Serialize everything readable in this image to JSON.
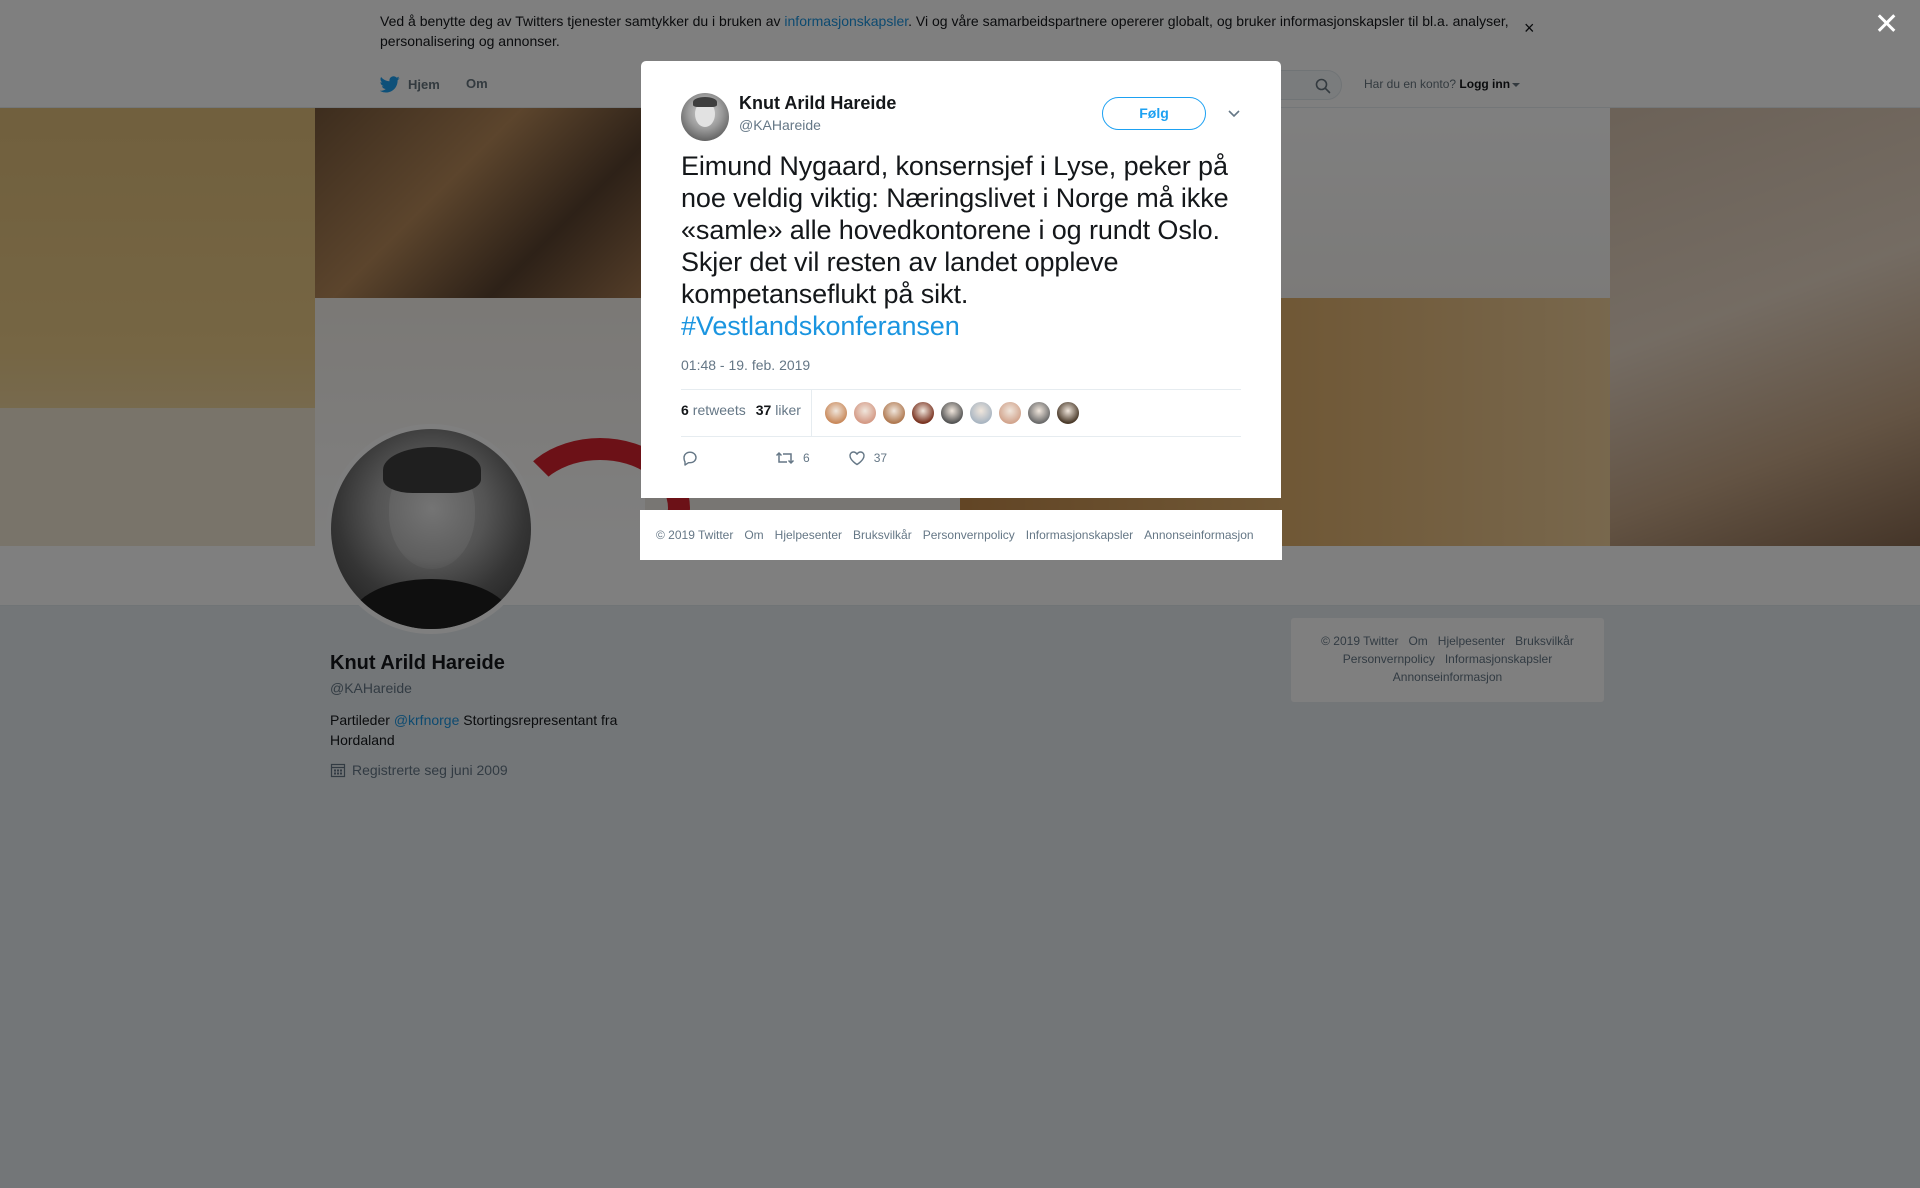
{
  "cookie_banner": {
    "text_before": "Ved å benytte deg av Twitters tjenester samtykker du i bruken av ",
    "link": "informasjonskapsler",
    "text_after": ". Vi og våre samarbeidspartnere opererer globalt, og bruker informasjonskapsler til bl.a. analyser, personalisering og annonser.",
    "close": "×"
  },
  "nav": {
    "home": "Hjem",
    "about": "Om",
    "login_prompt": "Har du en konto?",
    "login": "Logg inn"
  },
  "profile": {
    "name": "Knut Arild Hareide",
    "handle": "@KAHareide",
    "bio_before": "Partileder ",
    "bio_link": "@krfnorge",
    "bio_after": " Stortingsrepresentant fra Hordaland",
    "joined": "Registrerte seg juni 2009"
  },
  "sidebar_footer": {
    "items": [
      "© 2019 Twitter",
      "Om",
      "Hjelpesenter",
      "Bruksvilkår",
      "Personvernpolicy",
      "Informasjonskapsler",
      "Annonseinformasjon"
    ]
  },
  "overlay": {
    "close": "✕"
  },
  "tweet": {
    "name": "Knut Arild Hareide",
    "handle": "@KAHareide",
    "follow": "Følg",
    "text": "Eimund Nygaard, konsernsjef i Lyse, peker på noe veldig viktig: Næringslivet i Norge må ikke «samle» alle hovedkontorene i og rundt Oslo. Skjer det vil resten av landet oppleve kompetanseflukt på sikt.",
    "hashtag": "#Vestlandskonferansen",
    "timestamp": "01:48 - 19. feb. 2019",
    "retweets_count": "6",
    "retweets_label": "retweets",
    "likes_count": "37",
    "likes_label": "liker",
    "action_retweets": "6",
    "action_likes": "37",
    "liker_avatar_colors": [
      "#c98a5c",
      "#d49a86",
      "#b07a52",
      "#7a3422",
      "#555555",
      "#aab6c2",
      "#d2a58e",
      "#6b6b6b",
      "#4a3a2a"
    ]
  },
  "modal_footer": {
    "items": [
      "© 2019 Twitter",
      "Om",
      "Hjelpesenter",
      "Bruksvilkår",
      "Personvernpolicy",
      "Informasjonskapsler",
      "Annonseinformasjon"
    ]
  },
  "colors": {
    "twitter_blue": "#1da1f2",
    "link_blue": "#1b95e0",
    "krf_red": "#d9232e"
  }
}
